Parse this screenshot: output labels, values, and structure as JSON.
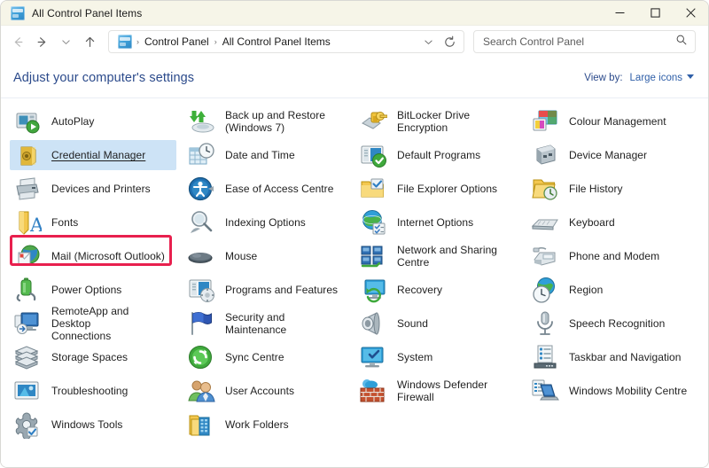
{
  "window": {
    "title": "All Control Panel Items",
    "title_icon": "control-panel-icon",
    "controls": {
      "minimize": "minimize-icon",
      "maximize": "maximize-icon",
      "close": "close-icon"
    }
  },
  "toolbar": {
    "back": "back-arrow-icon",
    "forward": "forward-arrow-icon",
    "recent": "chevron-down-icon",
    "up": "up-arrow-icon",
    "refresh": "refresh-icon",
    "address_dropdown": "chevron-down-icon",
    "breadcrumb": {
      "icon": "control-panel-icon",
      "separator": "›",
      "parts": [
        "Control Panel",
        "All Control Panel Items"
      ]
    }
  },
  "search": {
    "placeholder": "Search Control Panel",
    "value": "",
    "icon": "search-icon"
  },
  "content": {
    "heading": "Adjust your computer's settings",
    "view_by_label": "View by:",
    "view_by_value": "Large icons",
    "view_by_caret": "chevron-down-icon"
  },
  "colors": {
    "titlebar_bg": "#f6f5e8",
    "heading_text": "#2b4a8b",
    "link_text": "#2f5fa8",
    "hover_bg": "#cde3f6",
    "annotation": "#e8204e",
    "item_text": "#1f1f1f"
  },
  "annotation": {
    "target": "Mail (Microsoft Outlook)",
    "shape": "rectangle",
    "color": "#e8204e"
  },
  "items": [
    [
      {
        "label": "AutoPlay",
        "label2": "",
        "icon": "autoplay-icon",
        "hovered": false
      },
      {
        "label": "Back up and Restore",
        "label2": "(Windows 7)",
        "icon": "backup-restore-icon",
        "hovered": false
      },
      {
        "label": "BitLocker Drive Encryption",
        "label2": "",
        "icon": "bitlocker-icon",
        "hovered": false
      },
      {
        "label": "Colour Management",
        "label2": "",
        "icon": "colour-management-icon",
        "hovered": false
      }
    ],
    [
      {
        "label": "Credential Manager",
        "label2": "",
        "icon": "credential-manager-icon",
        "hovered": true
      },
      {
        "label": "Date and Time",
        "label2": "",
        "icon": "date-time-icon",
        "hovered": false
      },
      {
        "label": "Default Programs",
        "label2": "",
        "icon": "default-programs-icon",
        "hovered": false
      },
      {
        "label": "Device Manager",
        "label2": "",
        "icon": "device-manager-icon",
        "hovered": false
      }
    ],
    [
      {
        "label": "Devices and Printers",
        "label2": "",
        "icon": "devices-printers-icon",
        "hovered": false
      },
      {
        "label": "Ease of Access Centre",
        "label2": "",
        "icon": "ease-of-access-icon",
        "hovered": false
      },
      {
        "label": "File Explorer Options",
        "label2": "",
        "icon": "file-explorer-options-icon",
        "hovered": false
      },
      {
        "label": "File History",
        "label2": "",
        "icon": "file-history-icon",
        "hovered": false
      }
    ],
    [
      {
        "label": "Fonts",
        "label2": "",
        "icon": "fonts-icon",
        "hovered": false
      },
      {
        "label": "Indexing Options",
        "label2": "",
        "icon": "indexing-options-icon",
        "hovered": false
      },
      {
        "label": "Internet Options",
        "label2": "",
        "icon": "internet-options-icon",
        "hovered": false
      },
      {
        "label": "Keyboard",
        "label2": "",
        "icon": "keyboard-icon",
        "hovered": false
      }
    ],
    [
      {
        "label": "Mail (Microsoft Outlook)",
        "label2": "",
        "icon": "mail-outlook-icon",
        "hovered": false
      },
      {
        "label": "Mouse",
        "label2": "",
        "icon": "mouse-icon",
        "hovered": false
      },
      {
        "label": "Network and Sharing",
        "label2": "Centre",
        "icon": "network-sharing-icon",
        "hovered": false
      },
      {
        "label": "Phone and Modem",
        "label2": "",
        "icon": "phone-modem-icon",
        "hovered": false
      }
    ],
    [
      {
        "label": "Power Options",
        "label2": "",
        "icon": "power-options-icon",
        "hovered": false
      },
      {
        "label": "Programs and Features",
        "label2": "",
        "icon": "programs-features-icon",
        "hovered": false
      },
      {
        "label": "Recovery",
        "label2": "",
        "icon": "recovery-icon",
        "hovered": false
      },
      {
        "label": "Region",
        "label2": "",
        "icon": "region-icon",
        "hovered": false
      }
    ],
    [
      {
        "label": "RemoteApp and Desktop",
        "label2": "Connections",
        "icon": "remoteapp-icon",
        "hovered": false
      },
      {
        "label": "Security and Maintenance",
        "label2": "",
        "icon": "security-maintenance-icon",
        "hovered": false
      },
      {
        "label": "Sound",
        "label2": "",
        "icon": "sound-icon",
        "hovered": false
      },
      {
        "label": "Speech Recognition",
        "label2": "",
        "icon": "speech-recognition-icon",
        "hovered": false
      }
    ],
    [
      {
        "label": "Storage Spaces",
        "label2": "",
        "icon": "storage-spaces-icon",
        "hovered": false
      },
      {
        "label": "Sync Centre",
        "label2": "",
        "icon": "sync-centre-icon",
        "hovered": false
      },
      {
        "label": "System",
        "label2": "",
        "icon": "system-icon",
        "hovered": false
      },
      {
        "label": "Taskbar and Navigation",
        "label2": "",
        "icon": "taskbar-navigation-icon",
        "hovered": false
      }
    ],
    [
      {
        "label": "Troubleshooting",
        "label2": "",
        "icon": "troubleshooting-icon",
        "hovered": false
      },
      {
        "label": "User Accounts",
        "label2": "",
        "icon": "user-accounts-icon",
        "hovered": false
      },
      {
        "label": "Windows Defender",
        "label2": "Firewall",
        "icon": "windows-defender-firewall-icon",
        "hovered": false
      },
      {
        "label": "Windows Mobility Centre",
        "label2": "",
        "icon": "windows-mobility-icon",
        "hovered": false
      }
    ],
    [
      {
        "label": "Windows Tools",
        "label2": "",
        "icon": "windows-tools-icon",
        "hovered": false
      },
      {
        "label": "Work Folders",
        "label2": "",
        "icon": "work-folders-icon",
        "hovered": false
      },
      {
        "label": "",
        "label2": "",
        "icon": "",
        "hovered": false
      },
      {
        "label": "",
        "label2": "",
        "icon": "",
        "hovered": false
      }
    ]
  ]
}
